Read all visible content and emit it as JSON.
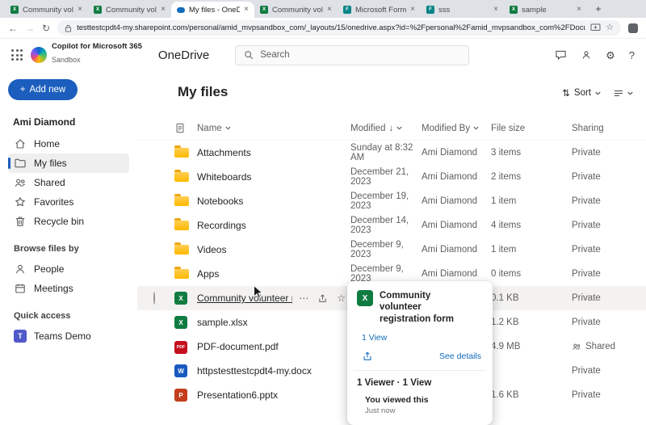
{
  "icons": {
    "back": "←",
    "forward": "→",
    "reload": "↻",
    "close": "×",
    "plus": "+",
    "ellipsis": "⋯",
    "star": "☆",
    "help": "?",
    "gear": "⚙",
    "sort": "⇅",
    "sort_desc": "↓"
  },
  "browser": {
    "tabs": [
      {
        "label": "Community volun...",
        "icon": "excel"
      },
      {
        "label": "Community volun...",
        "icon": "excel"
      },
      {
        "label": "My files - OneDriv...",
        "icon": "onedrive"
      },
      {
        "label": "Community volun...",
        "icon": "excel"
      },
      {
        "label": "Microsoft Forms",
        "icon": "forms"
      },
      {
        "label": "sss",
        "icon": "forms"
      },
      {
        "label": "sample",
        "icon": "excel"
      }
    ],
    "url": "testtestcpdt4-my.sharepoint.com/personal/amid_mvpsandbox_com/_layouts/15/onedrive.aspx?id=%2Fpersonal%2Famid_mvpsandbox_com%2FDocuments&vie..."
  },
  "header": {
    "brand_line1": "Copilot for Microsoft 365",
    "brand_line2": "Sandbox",
    "app_name": "OneDrive",
    "search_placeholder": "Search"
  },
  "sidebar": {
    "add_new_label": "Add new",
    "user_name": "Ami Diamond",
    "items": [
      {
        "label": "Home"
      },
      {
        "label": "My files"
      },
      {
        "label": "Shared"
      },
      {
        "label": "Favorites"
      },
      {
        "label": "Recycle bin"
      }
    ],
    "browse_heading": "Browse files by",
    "browse_items": [
      {
        "label": "People"
      },
      {
        "label": "Meetings"
      }
    ],
    "quick_heading": "Quick access",
    "quick_items": [
      {
        "label": "Teams Demo"
      }
    ]
  },
  "main": {
    "title": "My files",
    "toolbar": {
      "sort_label": "Sort"
    },
    "columns": {
      "name": "Name",
      "modified": "Modified",
      "modified_by": "Modified By",
      "file_size": "File size",
      "sharing": "Sharing"
    },
    "rows": [
      {
        "icon": "folder",
        "name": "Attachments",
        "modified": "Sunday at 8:32 AM",
        "modified_by": "Ami Diamond",
        "size": "3 items",
        "sharing": "Private"
      },
      {
        "icon": "folder",
        "name": "Whiteboards",
        "modified": "December 21, 2023",
        "modified_by": "Ami Diamond",
        "size": "2 items",
        "sharing": "Private"
      },
      {
        "icon": "folder",
        "name": "Notebooks",
        "modified": "December 19, 2023",
        "modified_by": "Ami Diamond",
        "size": "1 item",
        "sharing": "Private"
      },
      {
        "icon": "folder",
        "name": "Recordings",
        "modified": "December 14, 2023",
        "modified_by": "Ami Diamond",
        "size": "4 items",
        "sharing": "Private"
      },
      {
        "icon": "folder",
        "name": "Videos",
        "modified": "December 9, 2023",
        "modified_by": "Ami Diamond",
        "size": "1 item",
        "sharing": "Private"
      },
      {
        "icon": "folder",
        "name": "Apps",
        "modified": "December 9, 2023",
        "modified_by": "Ami Diamond",
        "size": "0 items",
        "sharing": "Private"
      },
      {
        "icon": "excel",
        "name": "Community volunteer registr...",
        "modified": "",
        "modified_by": "",
        "size": "0.1 KB",
        "sharing": "Private"
      },
      {
        "icon": "excel",
        "name": "sample.xlsx",
        "modified": "",
        "modified_by": "",
        "size": "1.2 KB",
        "sharing": "Private"
      },
      {
        "icon": "pdf",
        "name": "PDF-document.pdf",
        "modified": "",
        "modified_by": "",
        "size": "4.9 MB",
        "sharing": "Shared"
      },
      {
        "icon": "word",
        "name": "httpstesttestcpdt4-my.docx",
        "modified": "",
        "modified_by": "",
        "size": "",
        "sharing": "Private"
      },
      {
        "icon": "ppt",
        "name": "Presentation6.pptx",
        "modified": "",
        "modified_by": "",
        "size": "1.6 KB",
        "sharing": "Private"
      }
    ]
  },
  "hover_card": {
    "title": "Community volunteer registration form",
    "views": "1 View",
    "see_details": "See details",
    "summary": "1 Viewer · 1 View",
    "viewer_name": "You viewed this",
    "viewer_time": "Just now"
  }
}
